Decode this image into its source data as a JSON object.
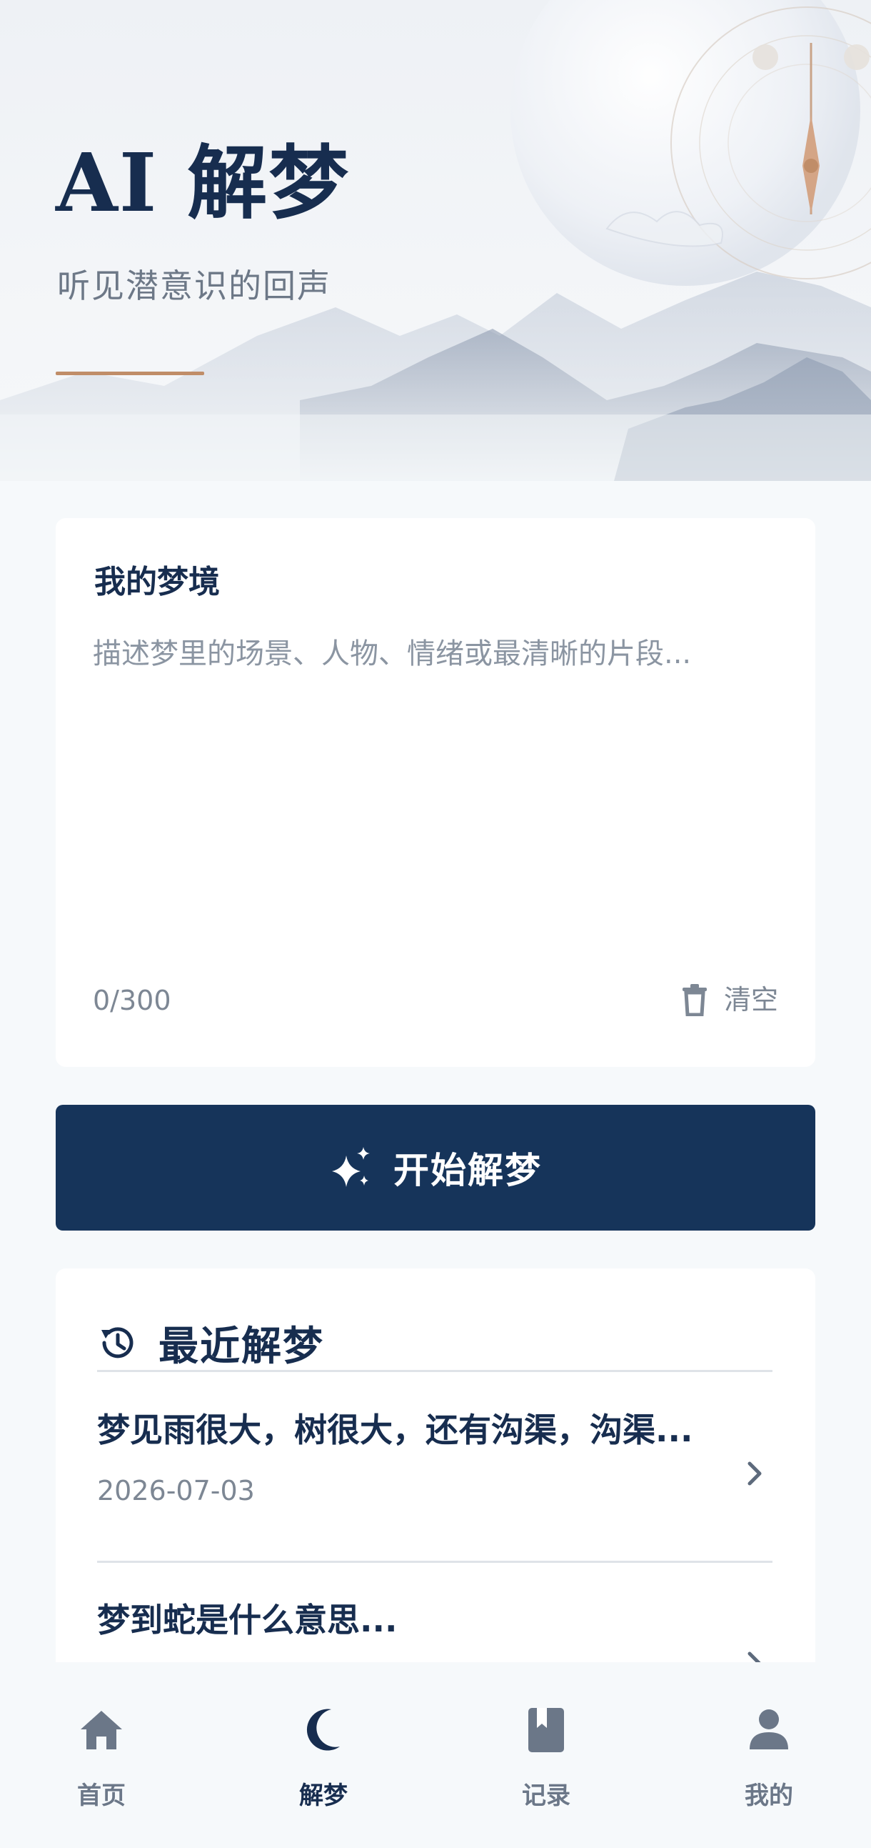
{
  "hero": {
    "title": "AI 解梦",
    "subtitle": "听见潜意识的回声"
  },
  "input_card": {
    "title": "我的梦境",
    "placeholder": "描述梦里的场景、人物、情绪或最清晰的片段...",
    "value": "",
    "char_count": "0/300",
    "clear_label": "清空",
    "clear_icon": "trash-icon"
  },
  "start_button": {
    "label": "开始解梦",
    "icon": "sparkles-icon"
  },
  "recent": {
    "title": "最近解梦",
    "icon": "history-icon",
    "items": [
      {
        "text": "梦见雨很大，树很大，还有沟渠，沟渠...",
        "date": "2026-07-03"
      },
      {
        "text": "梦到蛇是什么意思...",
        "date": ""
      }
    ]
  },
  "tabbar": {
    "items": [
      {
        "label": "首页",
        "icon": "home-icon",
        "active": false
      },
      {
        "label": "解梦",
        "icon": "moon-icon",
        "active": true
      },
      {
        "label": "记录",
        "icon": "book-icon",
        "active": false
      },
      {
        "label": "我的",
        "icon": "user-icon",
        "active": false
      }
    ]
  },
  "colors": {
    "primary": "#16345a",
    "title": "#172d4f",
    "accent_line": "#c08d68",
    "muted": "#7d8794",
    "background": "#f6f9fb"
  }
}
